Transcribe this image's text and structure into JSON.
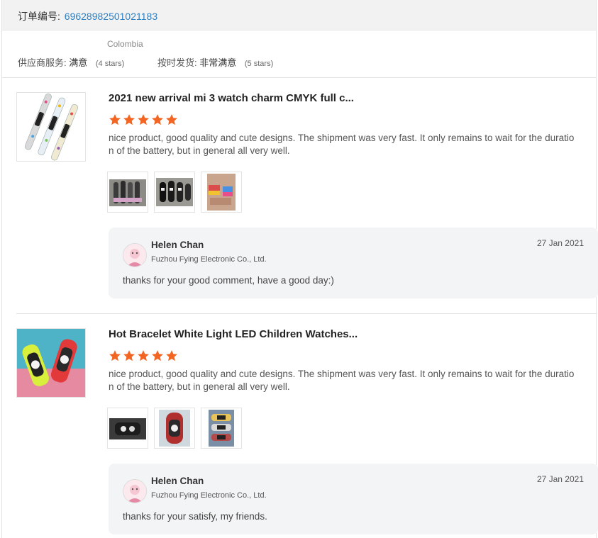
{
  "order": {
    "label": "订单编号:",
    "id": "69628982501021183"
  },
  "seller_info": {
    "country": "Colombia",
    "service": {
      "label": "供应商服务:",
      "value": "满意",
      "stars_text": "(4 stars)",
      "stars": 4
    },
    "shipping": {
      "label": "按时发货:",
      "value": "非常满意",
      "stars_text": "(5 stars)",
      "stars": 5
    }
  },
  "colors": {
    "link": "#2f7fc1",
    "star": "#f26522",
    "reply_bg": "#f3f4f5",
    "header_bg": "#f2f2f2"
  },
  "reviews": [
    {
      "product_title": "2021 new arrival mi 3 watch charm CMYK full c...",
      "rating": 5,
      "text": "nice product, good quality and cute designs. The shipment was very fast. It only remains to wait for the duration of the battery, but in general all very well.",
      "reply": {
        "name": "Helen Chan",
        "company": "Fuzhou Fying Electronic Co., Ltd.",
        "date": "27 Jan 2021",
        "text": "thanks for your good comment, have a good day:)"
      }
    },
    {
      "product_title": "Hot Bracelet White Light LED Children Watches...",
      "rating": 5,
      "text": "nice product, good quality and cute designs. The shipment was very fast. It only remains to wait for the duration of the battery, but in general all very well.",
      "reply": {
        "name": "Helen Chan",
        "company": "Fuzhou Fying Electronic Co., Ltd.",
        "date": "27 Jan 2021",
        "text": "thanks for your satisfy, my friends."
      }
    }
  ]
}
